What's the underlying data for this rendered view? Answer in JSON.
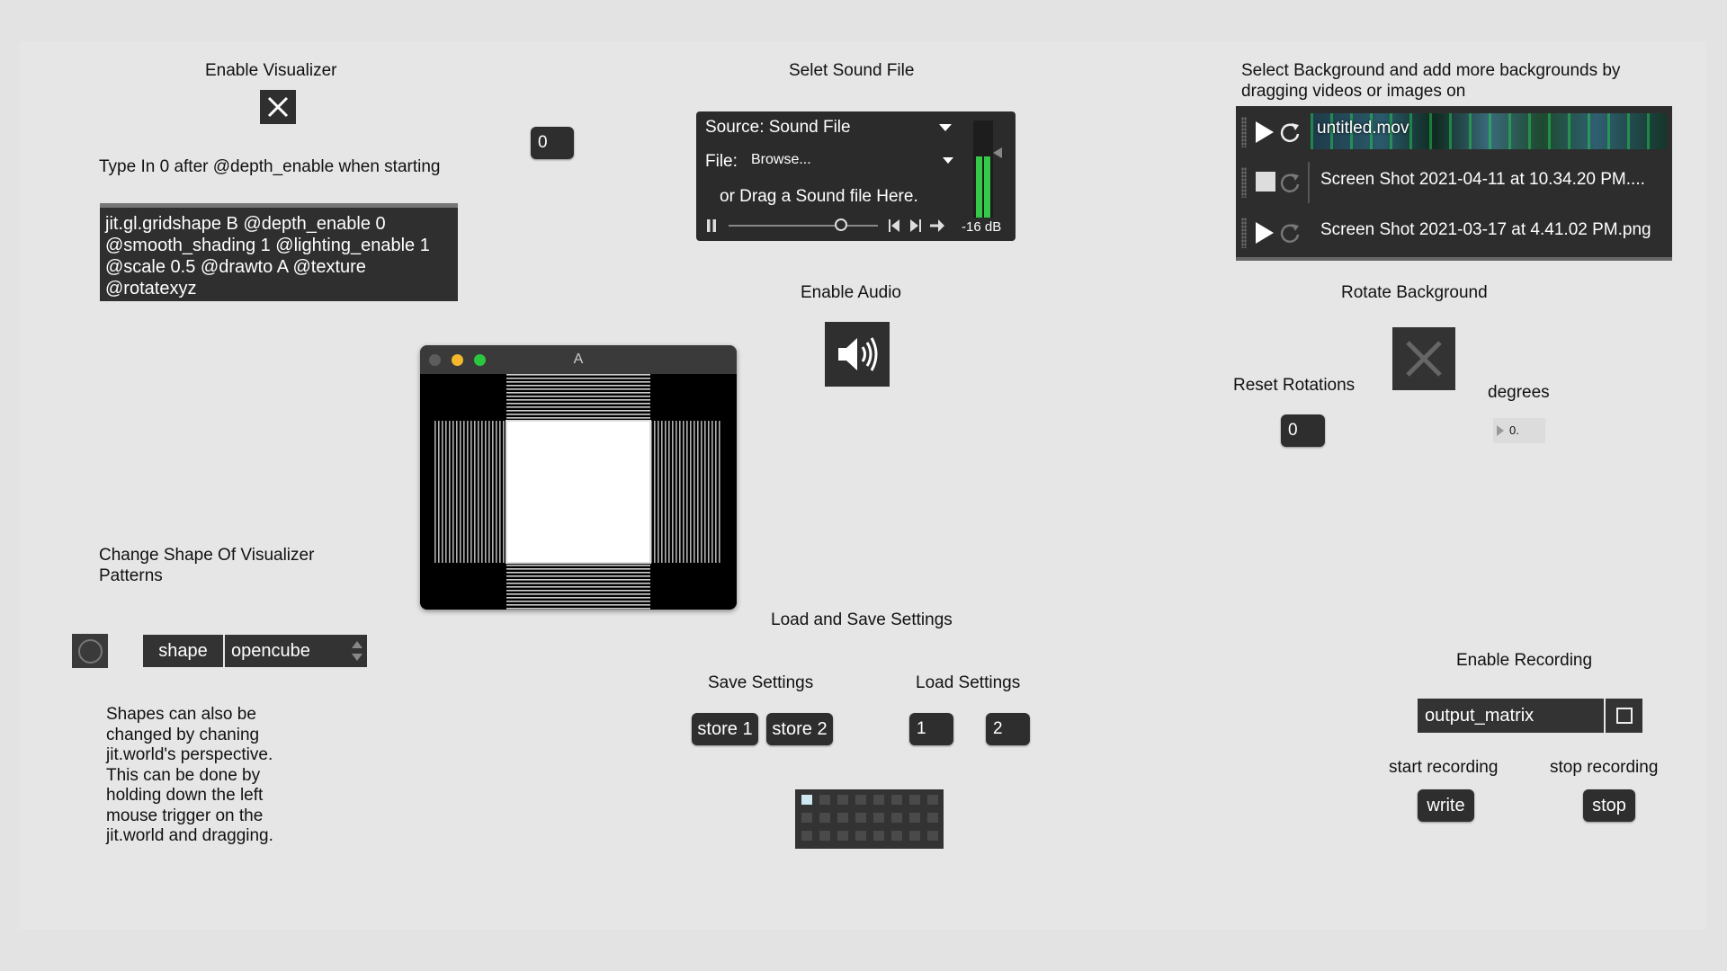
{
  "visualizer": {
    "enable_label": "Enable Visualizer",
    "hint": "Type In 0 after @depth_enable when starting",
    "message": "jit.gl.gridshape B @depth_enable 0 @smooth_shading 1 @lighting_enable 1 @scale 0.5 @drawto A @texture @rotatexyz",
    "depth_number": "0"
  },
  "sound": {
    "label": "Selet Sound File",
    "source": "Source: Sound File",
    "file_label": "File:",
    "file_value": "Browse...",
    "drag_hint": "or Drag a Sound file Here.",
    "level_db": "-16 dB",
    "playhead_fraction": 0.75
  },
  "audio": {
    "label": "Enable Audio"
  },
  "window": {
    "title": "A"
  },
  "shape": {
    "label": "Change Shape Of Visualizer Patterns",
    "shape_message": "shape",
    "selected": "opencube",
    "note": "Shapes can also be changed by chaning jit.world's perspective. This can be done by holding down the left mouse trigger on the jit.world and dragging."
  },
  "settings": {
    "label": "Load and Save Settings",
    "save_label": "Save Settings",
    "load_label": "Load Settings",
    "store1": "store 1",
    "store2": "store 2",
    "load1": "1",
    "load2": "2"
  },
  "background": {
    "label": "Select Background and add more backgrounds by dragging videos or images on",
    "items": [
      {
        "name": "untitled.mov",
        "state": "play"
      },
      {
        "name": "Screen Shot 2021-04-11 at 10.34.20 PM....",
        "state": "stop"
      },
      {
        "name": "Screen Shot 2021-03-17 at 4.41.02 PM.png",
        "state": "play"
      }
    ],
    "rotate_label": "Rotate Background",
    "reset_label": "Reset Rotations",
    "reset_value": "0",
    "degrees_label": "degrees",
    "degrees_value": "0."
  },
  "recording": {
    "label": "Enable Recording",
    "matrix_name": "output_matrix",
    "start_label": "start recording",
    "stop_label": "stop recording",
    "write": "write",
    "stop": "stop"
  },
  "colors": {
    "meter_green": "#35c94a",
    "panel_dark": "#2e2e2e",
    "background": "#e3e3e3"
  }
}
